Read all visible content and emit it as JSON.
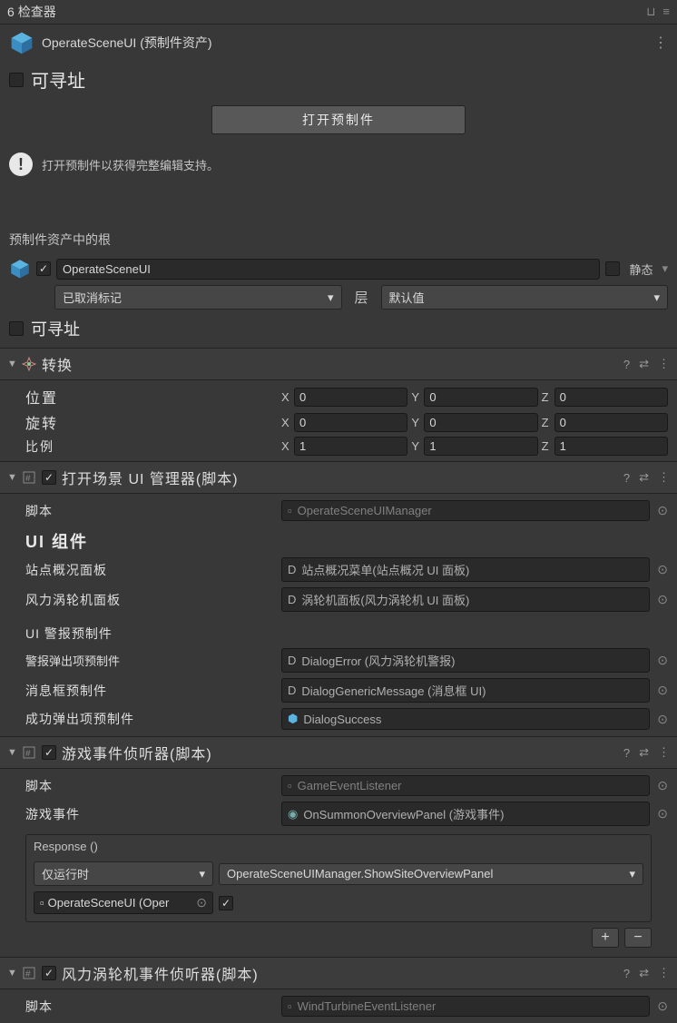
{
  "tab": {
    "title": "检查器",
    "prefix": "6"
  },
  "prefab": {
    "name": "OperateSceneUI",
    "suffix": "(预制件资产)"
  },
  "addressable_label": "可寻址",
  "open_prefab_btn": "打开预制件",
  "info_text": "打开预制件以获得完整编辑支持。",
  "root_label": "预制件资产中的根",
  "go": {
    "name": "OperateSceneUI",
    "static_label": "静态",
    "tag": "已取消标记",
    "layer_label": "层",
    "layer": "默认值"
  },
  "transform": {
    "title": "转换",
    "position": {
      "label": "位置",
      "x": "0",
      "y": "0",
      "z": "0"
    },
    "rotation": {
      "label": "旋转",
      "x": "0",
      "y": "0",
      "z": "0"
    },
    "scale": {
      "label": "比例",
      "x": "1",
      "y": "1",
      "z": "1"
    }
  },
  "comp1": {
    "title": "打开场景 UI 管理器(脚本)",
    "script_label": "脚本",
    "script_value": "OperateSceneUIManager",
    "ui_heading": "UI 组件",
    "site_panel_label": "站点概况面板",
    "site_panel_value": "站点概况菜单(站点概况 UI 面板)",
    "turbine_panel_label": "风力涡轮机面板",
    "turbine_panel_value": "涡轮机面板(风力涡轮机 UI 面板)",
    "alert_prefab_label": "UI 警报预制件",
    "alert_popup_label": "警报弹出项预制件",
    "alert_popup_value": "DialogError (风力涡轮机警报)",
    "msg_prefab_label": "消息框预制件",
    "msg_prefab_value": "DialogGenericMessage (消息框 UI)",
    "success_label": "成功弹出项预制件",
    "success_value": "DialogSuccess"
  },
  "comp2": {
    "title": "游戏事件侦听器(脚本)",
    "script_label": "脚本",
    "script_value": "GameEventListener",
    "event_label": "游戏事件",
    "event_value": "OnSummonOverviewPanel (游戏事件)",
    "response_title": "Response ()",
    "runtime_mode": "仅运行时",
    "callback": "OperateSceneUIManager.ShowSiteOverviewPanel",
    "target": "OperateSceneUI (Oper"
  },
  "comp3": {
    "title": "风力涡轮机事件侦听器(脚本)",
    "script_label": "脚本",
    "script_value": "WindTurbineEventListener"
  },
  "labels": {
    "x": "X",
    "y": "Y",
    "z": "Z",
    "d_prefix": "D"
  }
}
